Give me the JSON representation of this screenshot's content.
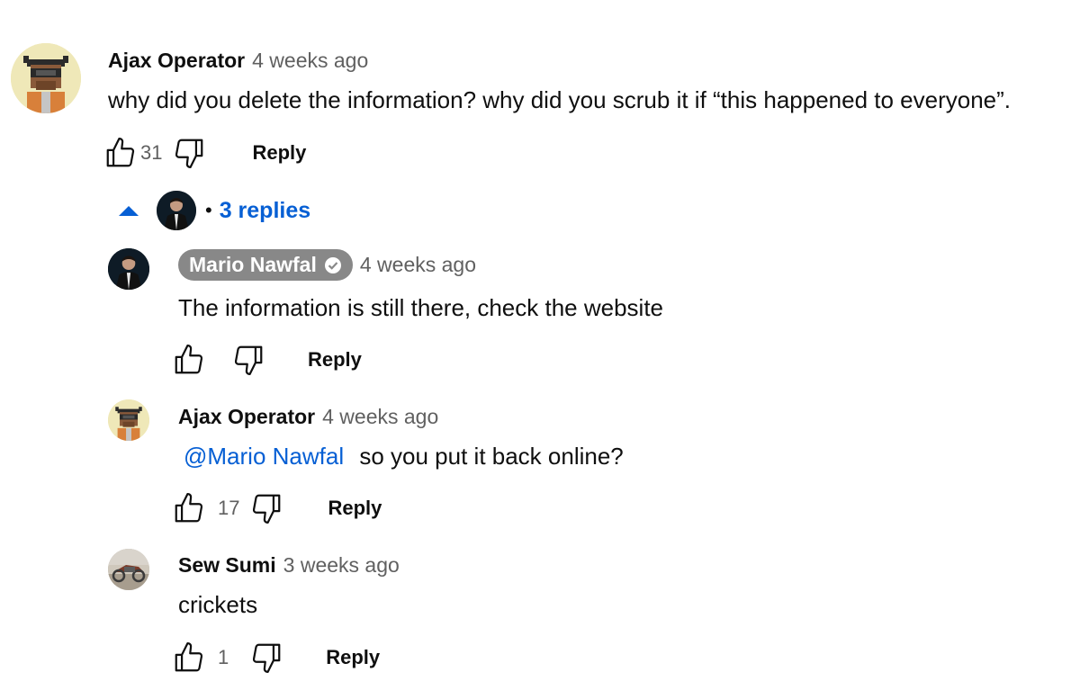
{
  "thread": {
    "top": {
      "author": "Ajax Operator",
      "time": "4 weeks ago",
      "text": "why did you delete the information? why did you scrub it if “this happened to everyone”.",
      "likes": "31",
      "reply_label": "Reply",
      "avatar_icon": "pixel-bull-avatar-icon"
    },
    "replies_toggle": {
      "count_label": "3 replies",
      "separator": "•"
    },
    "replies": [
      {
        "author": "Mario Nawfal",
        "time": "4 weeks ago",
        "text": "The information is still there, check the website",
        "likes": "",
        "reply_label": "Reply",
        "verified": true
      },
      {
        "author": "Ajax Operator",
        "time": "4 weeks ago",
        "mention": "@Mario Nawfal",
        "text": "so you put it back online?",
        "likes": "17",
        "reply_label": "Reply"
      },
      {
        "author": "Sew Sumi",
        "time": "3 weeks ago",
        "text": "crickets",
        "likes": "1",
        "reply_label": "Reply"
      }
    ]
  },
  "colors": {
    "link_blue": "#065fd4",
    "secondary_text": "#606060",
    "creator_pill": "#888888"
  }
}
